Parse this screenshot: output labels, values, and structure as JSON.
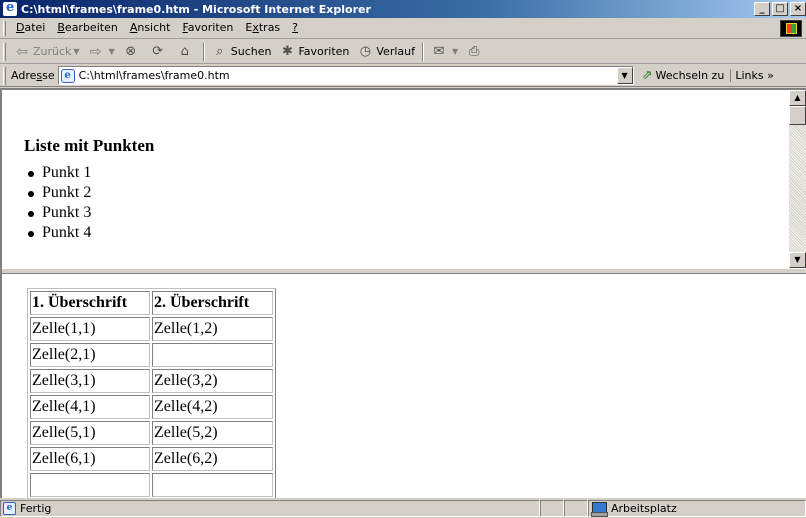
{
  "window": {
    "title": "C:\\html\\frames\\frame0.htm - Microsoft Internet Explorer",
    "buttons": {
      "minimize": "_",
      "maximize": "□",
      "close": "×"
    }
  },
  "menu": {
    "items": [
      {
        "accel": "D",
        "rest": "atei"
      },
      {
        "accel": "B",
        "rest": "earbeiten"
      },
      {
        "accel": "A",
        "rest": "nsicht"
      },
      {
        "accel": "F",
        "rest": "avoriten"
      },
      {
        "pre": "E",
        "accel": "x",
        "rest": "tras"
      },
      {
        "accel": "?",
        "rest": ""
      }
    ]
  },
  "toolbar": {
    "back_label": "Zurück",
    "search_label": "Suchen",
    "favorites_label": "Favoriten",
    "history_label": "Verlauf",
    "icons": {
      "back": "back-arrow-icon",
      "forward": "forward-arrow-icon",
      "stop": "stop-icon",
      "refresh": "refresh-icon",
      "home": "home-icon",
      "search": "search-icon",
      "favorites": "favorites-icon",
      "history": "history-icon",
      "mail": "mail-icon",
      "print": "print-icon"
    }
  },
  "address": {
    "label_pre": "Adre",
    "label_accel": "s",
    "label_post": "se",
    "value": "C:\\html\\frames\\frame0.htm",
    "go_label": "Wechseln zu",
    "links_label": "Links"
  },
  "top_frame": {
    "heading": "Liste mit Punkten",
    "items": [
      "Punkt 1",
      "Punkt 2",
      "Punkt 3",
      "Punkt 4"
    ]
  },
  "bottom_frame": {
    "headers": [
      "1. Überschrift",
      "2. Überschrift"
    ],
    "rows": [
      [
        "Zelle(1,1)",
        "Zelle(1,2)"
      ],
      [
        "Zelle(2,1)",
        ""
      ],
      [
        "Zelle(3,1)",
        "Zelle(3,2)"
      ],
      [
        "Zelle(4,1)",
        "Zelle(4,2)"
      ],
      [
        "Zelle(5,1)",
        "Zelle(5,2)"
      ],
      [
        "Zelle(6,1)",
        "Zelle(6,2)"
      ],
      [
        "",
        ""
      ]
    ]
  },
  "status": {
    "text": "Fertig",
    "zone": "Arbeitsplatz"
  }
}
